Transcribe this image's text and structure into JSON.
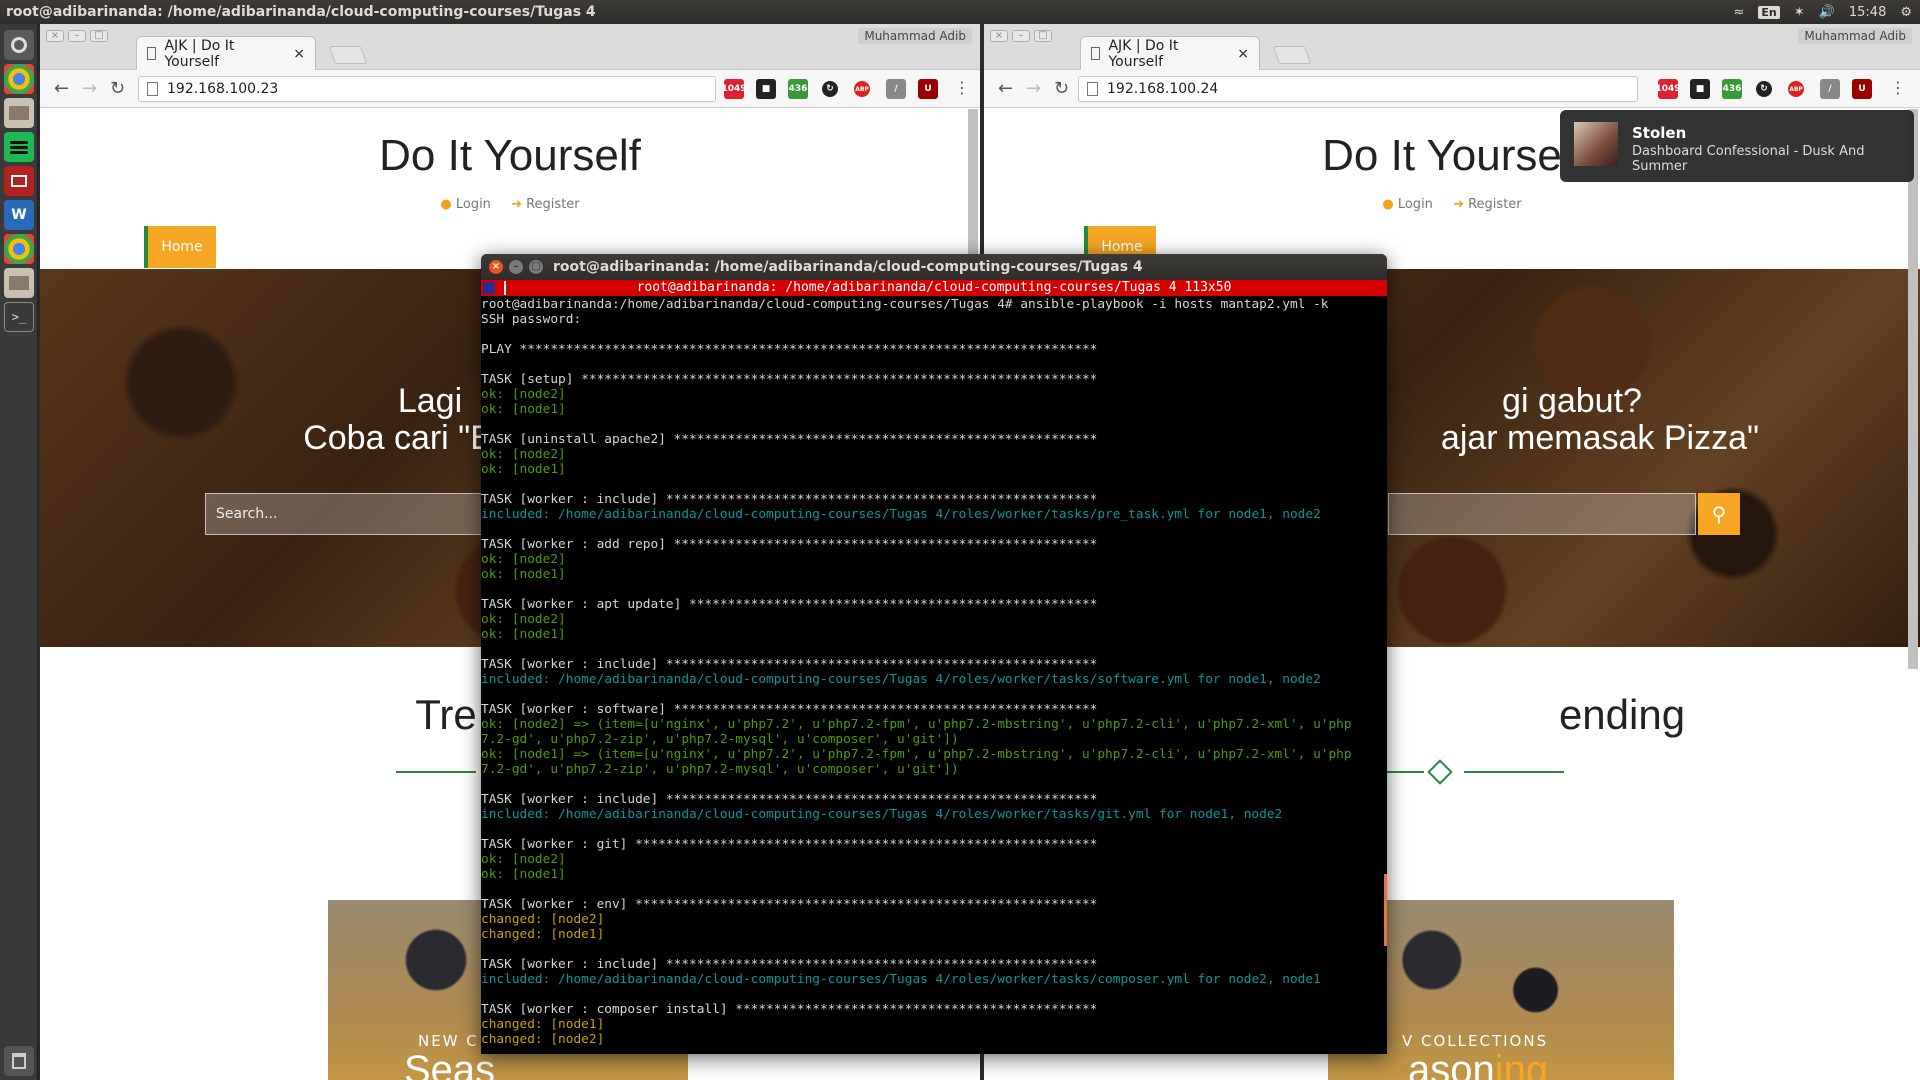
{
  "top_panel": {
    "title": "root@adibarinanda: /home/adibarinanda/cloud-computing-courses/Tugas 4",
    "lang": "En",
    "time": "15:48"
  },
  "launcher": {
    "items": [
      "dash-home-icon",
      "chrome-icon",
      "files-icon",
      "spotify-icon",
      "screenshot-icon",
      "vmware-icon",
      "chrome-icon",
      "files-icon",
      "terminal-icon"
    ],
    "trash": "trash-icon"
  },
  "left_browser": {
    "tab_title": "AJK | Do It Yourself",
    "user": "Muhammad Adib",
    "url": "192.168.100.23",
    "ext_gmail_count": "1049",
    "ext_green_count": "436",
    "ext_abp": "ABP"
  },
  "right_browser": {
    "tab_title": "AJK | Do It Yourself",
    "user": "Muhammad Adib",
    "url": "192.168.100.24",
    "ext_gmail_count": "1049",
    "ext_green_count": "436",
    "ext_abp": "ABP"
  },
  "site": {
    "title": "Do It Yourself",
    "login": "Login",
    "register": "Register",
    "home": "Home",
    "hero_line1": "Lagi gabut?",
    "hero_line2": "Coba cari \"Belajar memasak Pizza\"",
    "search_placeholder": "Search...",
    "trending": "Trending",
    "card_sub": "NEW COLLECTIONS",
    "card_big_a": "Seas",
    "card_big_b": "oning",
    "card_big_c": "ing",
    "left_hero_1": "Lagi",
    "left_hero_2": "Coba cari \"Belaja",
    "right_hero_1": "gi gabut?",
    "right_hero_2": "ajar memasak Pizza\"",
    "left_trending": "Tre",
    "right_trending": "ending",
    "left_card_sub": "NEW C",
    "right_card_sub": "V COLLECTIONS",
    "right_card_big": "asoning",
    "right_title_partial": "Do It Yourse"
  },
  "notification": {
    "title": "Stolen",
    "body": "Dashboard Confessional - Dusk And Summer"
  },
  "terminal": {
    "title": "root@adibarinanda: /home/adibarinanda/cloud-computing-courses/Tugas 4",
    "tmux_bar": "root@adibarinanda: /home/adibarinanda/cloud-computing-courses/Tugas 4 113x50",
    "lines": [
      {
        "c": "w",
        "t": "root@adibarinanda:/home/adibarinanda/cloud-computing-courses/Tugas 4# ansible-playbook -i hosts mantap2.yml -k"
      },
      {
        "c": "w",
        "t": "SSH password:"
      },
      {
        "c": "w",
        "t": ""
      },
      {
        "c": "w",
        "t": "PLAY ***************************************************************************"
      },
      {
        "c": "w",
        "t": ""
      },
      {
        "c": "w",
        "t": "TASK [setup] *******************************************************************"
      },
      {
        "c": "ok",
        "t": "ok: [node2]"
      },
      {
        "c": "ok",
        "t": "ok: [node1]"
      },
      {
        "c": "w",
        "t": ""
      },
      {
        "c": "w",
        "t": "TASK [uninstall apache2] *******************************************************"
      },
      {
        "c": "ok",
        "t": "ok: [node2]"
      },
      {
        "c": "ok",
        "t": "ok: [node1]"
      },
      {
        "c": "w",
        "t": ""
      },
      {
        "c": "w",
        "t": "TASK [worker : include] ********************************************************"
      },
      {
        "c": "inc",
        "t": "included: /home/adibarinanda/cloud-computing-courses/Tugas 4/roles/worker/tasks/pre_task.yml for node1, node2"
      },
      {
        "c": "w",
        "t": ""
      },
      {
        "c": "w",
        "t": "TASK [worker : add repo] *******************************************************"
      },
      {
        "c": "ok",
        "t": "ok: [node2]"
      },
      {
        "c": "ok",
        "t": "ok: [node1]"
      },
      {
        "c": "w",
        "t": ""
      },
      {
        "c": "w",
        "t": "TASK [worker : apt update] *****************************************************"
      },
      {
        "c": "ok",
        "t": "ok: [node2]"
      },
      {
        "c": "ok",
        "t": "ok: [node1]"
      },
      {
        "c": "w",
        "t": ""
      },
      {
        "c": "w",
        "t": "TASK [worker : include] ********************************************************"
      },
      {
        "c": "inc",
        "t": "included: /home/adibarinanda/cloud-computing-courses/Tugas 4/roles/worker/tasks/software.yml for node1, node2"
      },
      {
        "c": "w",
        "t": ""
      },
      {
        "c": "w",
        "t": "TASK [worker : software] *******************************************************"
      },
      {
        "c": "ok",
        "t": "ok: [node2] => (item=[u'nginx', u'php7.2', u'php7.2-fpm', u'php7.2-mbstring', u'php7.2-cli', u'php7.2-xml', u'php"
      },
      {
        "c": "ok",
        "t": "7.2-gd', u'php7.2-zip', u'php7.2-mysql', u'composer', u'git'])"
      },
      {
        "c": "ok",
        "t": "ok: [node1] => (item=[u'nginx', u'php7.2', u'php7.2-fpm', u'php7.2-mbstring', u'php7.2-cli', u'php7.2-xml', u'php"
      },
      {
        "c": "ok",
        "t": "7.2-gd', u'php7.2-zip', u'php7.2-mysql', u'composer', u'git'])"
      },
      {
        "c": "w",
        "t": ""
      },
      {
        "c": "w",
        "t": "TASK [worker : include] ********************************************************"
      },
      {
        "c": "inc",
        "t": "included: /home/adibarinanda/cloud-computing-courses/Tugas 4/roles/worker/tasks/git.yml for node1, node2"
      },
      {
        "c": "w",
        "t": ""
      },
      {
        "c": "w",
        "t": "TASK [worker : git] ************************************************************"
      },
      {
        "c": "ok",
        "t": "ok: [node2]"
      },
      {
        "c": "ok",
        "t": "ok: [node1]"
      },
      {
        "c": "w",
        "t": ""
      },
      {
        "c": "w",
        "t": "TASK [worker : env] ************************************************************"
      },
      {
        "c": "ch",
        "t": "changed: [node2]"
      },
      {
        "c": "ch",
        "t": "changed: [node1]"
      },
      {
        "c": "w",
        "t": ""
      },
      {
        "c": "w",
        "t": "TASK [worker : include] ********************************************************"
      },
      {
        "c": "inc",
        "t": "included: /home/adibarinanda/cloud-computing-courses/Tugas 4/roles/worker/tasks/composer.yml for node2, node1"
      },
      {
        "c": "w",
        "t": ""
      },
      {
        "c": "w",
        "t": "TASK [worker : composer install] ***********************************************"
      },
      {
        "c": "ch",
        "t": "changed: [node1]"
      },
      {
        "c": "ch",
        "t": "changed: [node2]"
      }
    ]
  },
  "colors": {
    "accent_orange": "#f5a623",
    "accent_green": "#2a8a3c",
    "tmux_red": "#d70000",
    "ok_green": "#4e9a06",
    "included_cyan": "#06989a",
    "changed_yellow": "#c4a000"
  }
}
